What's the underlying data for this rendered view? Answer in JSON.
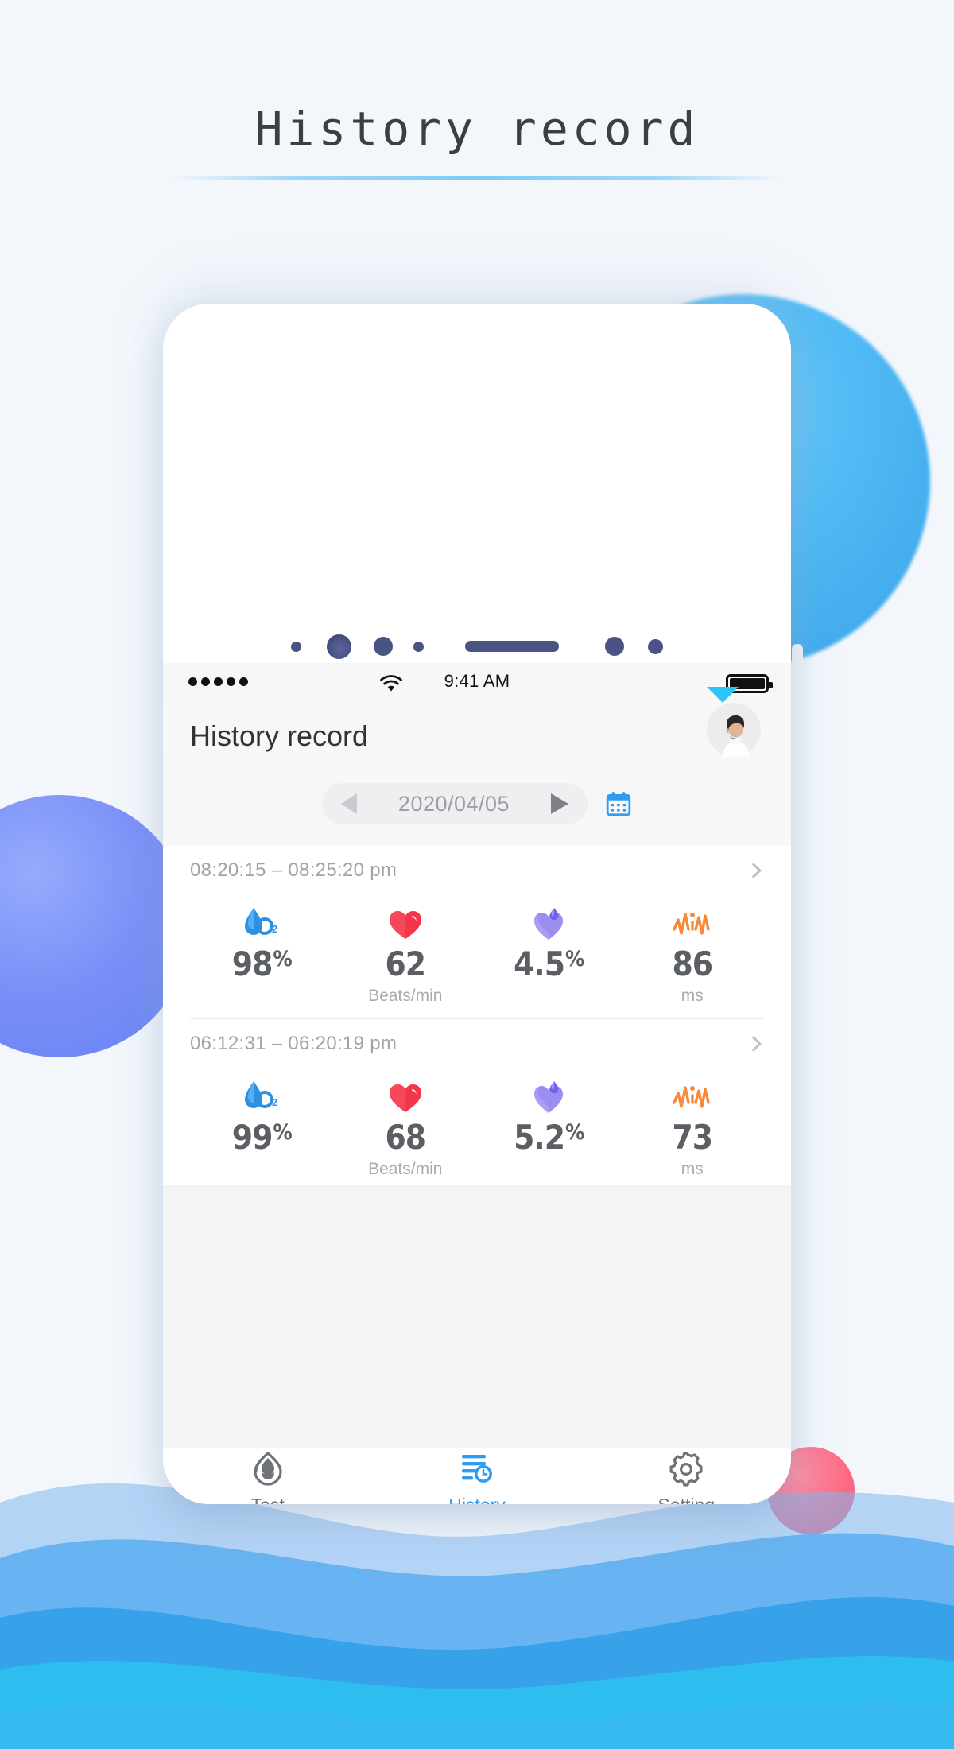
{
  "page": {
    "title": "History record"
  },
  "phone": {
    "status_bar": {
      "signal_dots": 5,
      "wifi_icon": "wifi-icon",
      "time": "9:41 AM",
      "battery_icon": "battery-full-icon"
    },
    "app_header": {
      "title": "History record",
      "avatar_name": "user-avatar"
    },
    "date_selector": {
      "prev_icon": "triangle-left-icon",
      "date": "2020/04/05",
      "next_icon": "triangle-right-icon",
      "calendar_icon": "calendar-icon",
      "calendar_color": "#2f9cf0"
    },
    "records": [
      {
        "time_range": "08:20:15 – 08:25:20 pm",
        "chevron": "chevron-right-icon",
        "metrics": [
          {
            "icon": "blood-oxygen-icon",
            "color": "#2f8fe0",
            "value": "98",
            "suffix": "%",
            "unit": ""
          },
          {
            "icon": "heart-icon",
            "color": "#f4354a",
            "value": "62",
            "suffix": "",
            "unit": "Beats/min"
          },
          {
            "icon": "perfusion-index-icon",
            "color": "#9a8ef0",
            "value": "4.5",
            "suffix": "%",
            "unit": ""
          },
          {
            "icon": "waveform-icon",
            "color": "#f7893a",
            "value": "86",
            "suffix": "",
            "unit": "ms"
          }
        ]
      },
      {
        "time_range": "06:12:31 – 06:20:19 pm",
        "chevron": "chevron-right-icon",
        "metrics": [
          {
            "icon": "blood-oxygen-icon",
            "color": "#2f8fe0",
            "value": "99",
            "suffix": "%",
            "unit": ""
          },
          {
            "icon": "heart-icon",
            "color": "#f4354a",
            "value": "68",
            "suffix": "",
            "unit": "Beats/min"
          },
          {
            "icon": "perfusion-index-icon",
            "color": "#9a8ef0",
            "value": "5.2",
            "suffix": "%",
            "unit": ""
          },
          {
            "icon": "waveform-icon",
            "color": "#f7893a",
            "value": "73",
            "suffix": "",
            "unit": "ms"
          }
        ]
      }
    ],
    "tabbar": {
      "active": "History",
      "active_color": "#2e9cf0",
      "inactive_color": "#6f7378",
      "items": [
        {
          "label": "Test",
          "icon": "test-drop-icon"
        },
        {
          "label": "History",
          "icon": "history-list-clock-icon"
        },
        {
          "label": "Setting",
          "icon": "gear-icon"
        }
      ]
    }
  }
}
